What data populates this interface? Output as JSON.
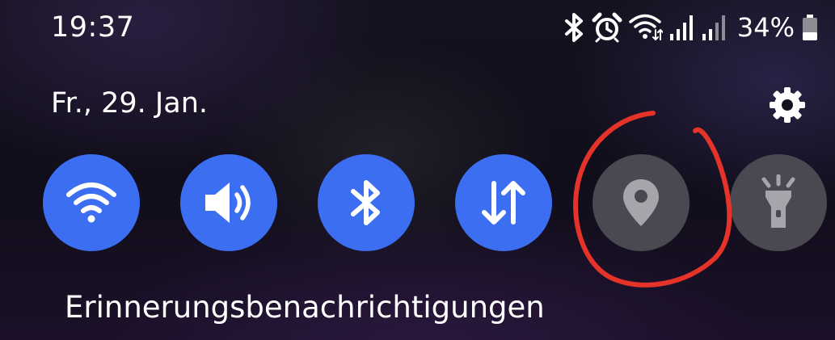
{
  "status_bar": {
    "time": "19:37",
    "battery_percent": "34%",
    "battery_level": 0.34,
    "icons": [
      "bluetooth-icon",
      "alarm-icon",
      "wifi-data-icon",
      "signal-icon",
      "signal-icon",
      "battery-icon"
    ]
  },
  "panel": {
    "date": "Fr., 29. Jan.",
    "settings_icon": "gear-icon"
  },
  "tiles": [
    {
      "icon": "wifi-icon",
      "state": "on"
    },
    {
      "icon": "sound-icon",
      "state": "on"
    },
    {
      "icon": "bluetooth-icon",
      "state": "on"
    },
    {
      "icon": "mobile-data-icon",
      "state": "on"
    },
    {
      "icon": "location-icon",
      "state": "off"
    },
    {
      "icon": "flashlight-icon",
      "state": "off"
    }
  ],
  "colors": {
    "tile_on": "#3c6ef2",
    "tile_off": "#4a4951",
    "annotation": "#e5332a",
    "icon_off": "#a6a5ab"
  },
  "notification": {
    "title": "Erinnerungsbenachrichtigungen"
  }
}
